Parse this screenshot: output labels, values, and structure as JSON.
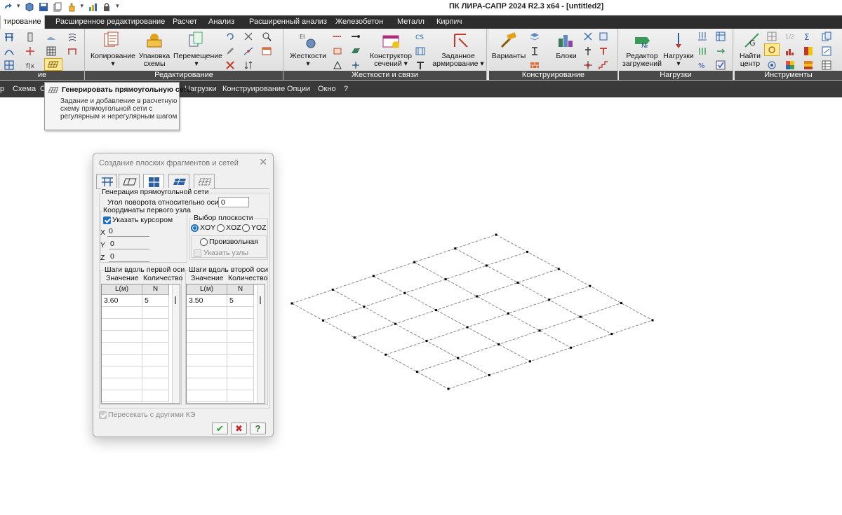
{
  "titlebar": {
    "app_title": "ПК ЛИРА-САПР  2024 R2.3 x64 - [untitled2]"
  },
  "ribbon_tabs": [
    "тирование",
    "Расширенное редактирование",
    "Расчет",
    "Анализ",
    "Расширенный анализ",
    "Железобетон",
    "Металл",
    "Кирпич"
  ],
  "ribbon_groups": {
    "edit_left": "ие",
    "editing": "Редактирование",
    "stiffness": "Жесткости и связи",
    "design": "Конструирование",
    "loads": "Нагрузки",
    "tools": "Инструменты"
  },
  "ribbon_buttons": {
    "copy": "Копирование",
    "pack_l1": "Упаковка",
    "pack_l2": "схемы",
    "move": "Перемещение",
    "stiff": "Жесткости",
    "section_l1": "Конструктор",
    "section_l2": "сечений",
    "reinf_l1": "Заданное",
    "reinf_l2": "армирование",
    "variants": "Варианты",
    "blocks": "Блоки",
    "load_editor_l1": "Редактор",
    "load_editor_l2": "загружений",
    "loads": "Нагрузки",
    "find_l1": "Найти",
    "find_l2": "центр"
  },
  "menubar": [
    "р",
    "Схема",
    "С",
    "Нагрузки",
    "Конструирование",
    "Опции",
    "Окно",
    "?"
  ],
  "tooltip": {
    "title": "Генерировать прямоугольную сеть",
    "body": "Задание и добавление в расчетную схему прямоугольной сети с регулярным и нерегулярным шагом"
  },
  "dialog": {
    "title": "Создание плоских фрагментов и сетей",
    "section_title": "Генерация прямоугольной сети",
    "angle_label": "Угол поворота относительно оси Z",
    "angle_value": "0",
    "first_node_label": "Координаты первого узла",
    "cursor_checkbox": "Указать курсором",
    "x_label": "X",
    "x_value": "0",
    "y_label": "Y",
    "y_value": "0",
    "z_label": "Z",
    "z_value": "0",
    "plane_label": "Выбор плоскости",
    "plane_options": [
      "XOY",
      "XOZ",
      "YOZ"
    ],
    "plane_selected": "XOY",
    "arbitrary_label": "Произвольная",
    "specify_nodes_label": "Указать узлы",
    "axis1": {
      "title": "Шаги вдоль первой оси",
      "col1_caption": "Значение",
      "col2_caption": "Количество",
      "col1_header": "L(м)",
      "col2_header": "N",
      "rows": [
        {
          "value": "3.60",
          "count": "5"
        }
      ]
    },
    "axis2": {
      "title": "Шаги вдоль второй оси",
      "col1_caption": "Значение",
      "col2_caption": "Количество",
      "col1_header": "L(м)",
      "col2_header": "N",
      "rows": [
        {
          "value": "3.50",
          "count": "5"
        }
      ]
    },
    "intersect_label": "Пересекать с другими КЭ",
    "ok_glyph": "✔",
    "cancel_glyph": "✖",
    "help_glyph": "?"
  },
  "mesh": {
    "nx": 5,
    "ny": 5
  },
  "colors": {
    "title_dark": "#2d2d2d",
    "menu_dark": "#3a3a3a",
    "accent_blue": "#1a6fc8",
    "ok_green": "#1e9e2b",
    "cancel_red": "#c62828",
    "help_green": "#2e7d32"
  }
}
